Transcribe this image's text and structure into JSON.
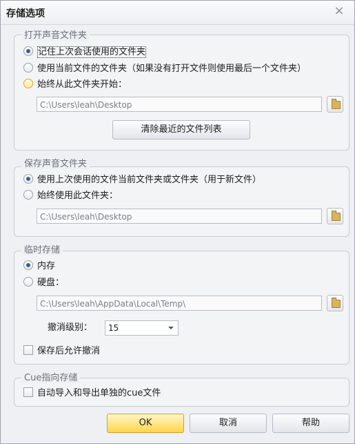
{
  "window": {
    "title": "存储选项",
    "close_glyph": "×"
  },
  "open_folder": {
    "legend": "打开声音文件夹",
    "opt_last_session": "记住上次会话使用的文件夹",
    "opt_current_file": "使用当前文件的文件夹（如果没有打开文件则使用最后一个文件夹）",
    "opt_always_from": "始终从此文件夹开始：",
    "path": "C:\\Users\\leah\\Desktop",
    "clear_recent_label": "清除最近的文件列表"
  },
  "save_folder": {
    "legend": "保存声音文件夹",
    "opt_last_used": "使用上次使用的文件当前文件夹或文件夹（用于新文件）",
    "opt_always_use": "始终使用此文件夹：",
    "path": "C:\\Users\\leah\\Desktop"
  },
  "temp_storage": {
    "legend": "临时存储",
    "opt_memory": "内存",
    "opt_disk": "硬盘：",
    "path": "C:\\Users\\leah\\AppData\\Local\\Temp\\",
    "undo_levels_label": "撤消级别：",
    "undo_levels_value": "15",
    "allow_undo_after_save": "保存后允许撤消"
  },
  "cue_storage": {
    "legend": "Cue指向存储",
    "auto_import_export": "自动导入和导出单独的cue文件"
  },
  "footer": {
    "ok_label": "OK",
    "cancel_label": "取消",
    "help_label": "帮助"
  }
}
